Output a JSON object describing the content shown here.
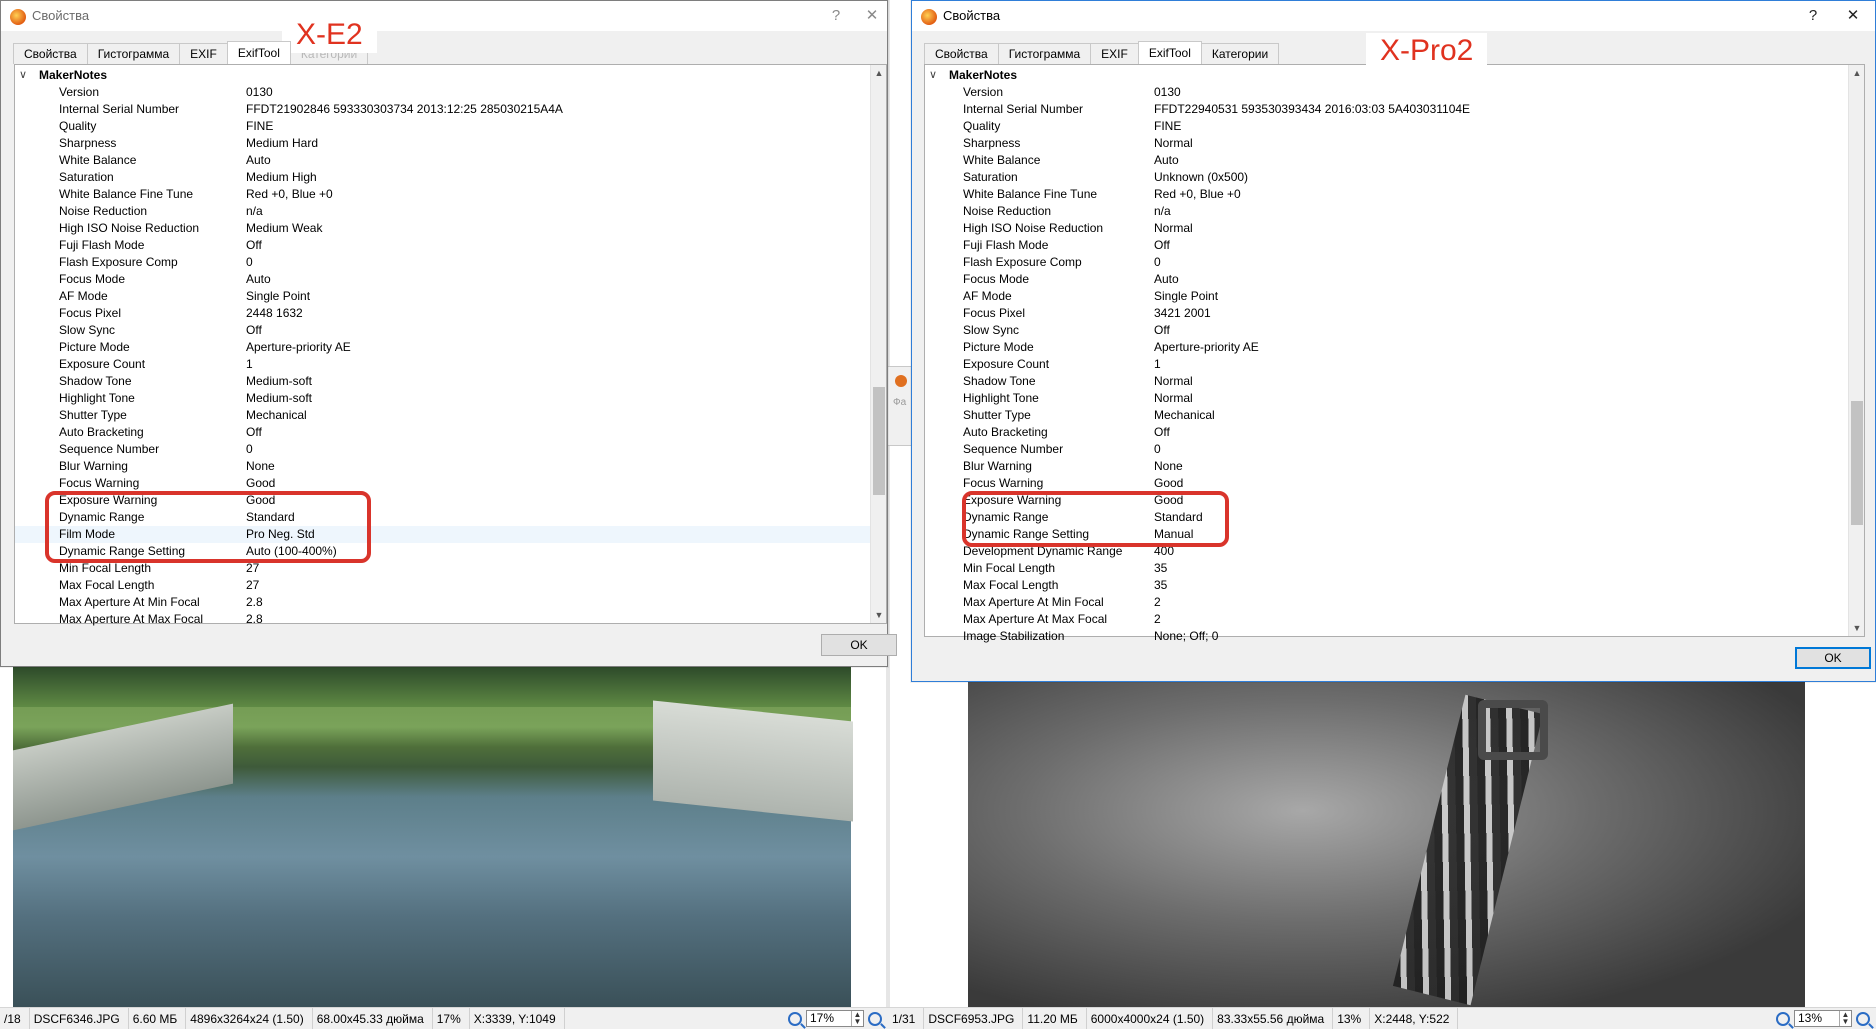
{
  "colors": {
    "annotation_red": "#d9342b",
    "selected_border": "#0078d7",
    "highlight_row": "#eef6fd"
  },
  "left": {
    "window_title": "Свойства",
    "help_symbol": "?",
    "close_symbol": "✕",
    "camera_label": "X-E2",
    "tabs": [
      "Свойства",
      "Гистограмма",
      "EXIF",
      "ExifTool",
      "Категории"
    ],
    "active_tab": "ExifTool",
    "section": "MakerNotes",
    "rows": [
      {
        "k": "Version",
        "v": "0130"
      },
      {
        "k": "Internal Serial Number",
        "v": "FFDT21902846 593330303734 2013:12:25 285030215A4A"
      },
      {
        "k": "Quality",
        "v": "FINE"
      },
      {
        "k": "Sharpness",
        "v": "Medium Hard"
      },
      {
        "k": "White Balance",
        "v": "Auto"
      },
      {
        "k": "Saturation",
        "v": "Medium High"
      },
      {
        "k": "White Balance Fine Tune",
        "v": "Red +0, Blue +0"
      },
      {
        "k": "Noise Reduction",
        "v": "n/a"
      },
      {
        "k": "High ISO Noise Reduction",
        "v": "Medium Weak"
      },
      {
        "k": "Fuji Flash Mode",
        "v": "Off"
      },
      {
        "k": "Flash Exposure Comp",
        "v": "0"
      },
      {
        "k": "Focus Mode",
        "v": "Auto"
      },
      {
        "k": "AF Mode",
        "v": "Single Point"
      },
      {
        "k": "Focus Pixel",
        "v": "2448 1632"
      },
      {
        "k": "Slow Sync",
        "v": "Off"
      },
      {
        "k": "Picture Mode",
        "v": "Aperture-priority AE"
      },
      {
        "k": "Exposure Count",
        "v": "1"
      },
      {
        "k": "Shadow Tone",
        "v": "Medium-soft"
      },
      {
        "k": "Highlight Tone",
        "v": "Medium-soft"
      },
      {
        "k": "Shutter Type",
        "v": "Mechanical"
      },
      {
        "k": "Auto Bracketing",
        "v": "Off"
      },
      {
        "k": "Sequence Number",
        "v": "0"
      },
      {
        "k": "Blur Warning",
        "v": "None"
      },
      {
        "k": "Focus Warning",
        "v": "Good"
      },
      {
        "k": "Exposure Warning",
        "v": "Good"
      },
      {
        "k": "Dynamic Range",
        "v": "Standard"
      },
      {
        "k": "Film Mode",
        "v": "Pro Neg. Std"
      },
      {
        "k": "Dynamic Range Setting",
        "v": "Auto (100-400%)"
      },
      {
        "k": "Min Focal Length",
        "v": "27"
      },
      {
        "k": "Max Focal Length",
        "v": "27"
      },
      {
        "k": "Max Aperture At Min Focal",
        "v": "2.8"
      },
      {
        "k": "Max Aperture At Max Focal",
        "v": "2.8"
      }
    ],
    "ok_label": "OK",
    "status": {
      "index": "/18",
      "file": "DSCF6346.JPG",
      "size": "6.60 МБ",
      "dims": "4896x3264x24 (1.50)",
      "inches": "68.00x45.33 дюйма",
      "zoom_pct": "17%",
      "coords": "X:3339, Y:1049",
      "zoom_box": "17%"
    }
  },
  "right": {
    "window_title": "Свойства",
    "help_symbol": "?",
    "close_symbol": "✕",
    "camera_label": "X-Pro2",
    "tabs": [
      "Свойства",
      "Гистограмма",
      "EXIF",
      "ExifTool",
      "Категории"
    ],
    "active_tab": "ExifTool",
    "section": "MakerNotes",
    "rows": [
      {
        "k": "Version",
        "v": "0130"
      },
      {
        "k": "Internal Serial Number",
        "v": "FFDT22940531 593530393434 2016:03:03 5A403031104E"
      },
      {
        "k": "Quality",
        "v": "FINE"
      },
      {
        "k": "Sharpness",
        "v": "Normal"
      },
      {
        "k": "White Balance",
        "v": "Auto"
      },
      {
        "k": "Saturation",
        "v": "Unknown (0x500)"
      },
      {
        "k": "White Balance Fine Tune",
        "v": "Red +0, Blue +0"
      },
      {
        "k": "Noise Reduction",
        "v": "n/a"
      },
      {
        "k": "High ISO Noise Reduction",
        "v": "Normal"
      },
      {
        "k": "Fuji Flash Mode",
        "v": "Off"
      },
      {
        "k": "Flash Exposure Comp",
        "v": "0"
      },
      {
        "k": "Focus Mode",
        "v": "Auto"
      },
      {
        "k": "AF Mode",
        "v": "Single Point"
      },
      {
        "k": "Focus Pixel",
        "v": "3421 2001"
      },
      {
        "k": "Slow Sync",
        "v": "Off"
      },
      {
        "k": "Picture Mode",
        "v": "Aperture-priority AE"
      },
      {
        "k": "Exposure Count",
        "v": "1"
      },
      {
        "k": "Shadow Tone",
        "v": "Normal"
      },
      {
        "k": "Highlight Tone",
        "v": "Normal"
      },
      {
        "k": "Shutter Type",
        "v": "Mechanical"
      },
      {
        "k": "Auto Bracketing",
        "v": "Off"
      },
      {
        "k": "Sequence Number",
        "v": "0"
      },
      {
        "k": "Blur Warning",
        "v": "None"
      },
      {
        "k": "Focus Warning",
        "v": "Good"
      },
      {
        "k": "Exposure Warning",
        "v": "Good"
      },
      {
        "k": "Dynamic Range",
        "v": "Standard"
      },
      {
        "k": "Dynamic Range Setting",
        "v": "Manual"
      },
      {
        "k": "Development Dynamic Range",
        "v": "400"
      },
      {
        "k": "Min Focal Length",
        "v": "35"
      },
      {
        "k": "Max Focal Length",
        "v": "35"
      },
      {
        "k": "Max Aperture At Min Focal",
        "v": "2"
      },
      {
        "k": "Max Aperture At Max Focal",
        "v": "2"
      },
      {
        "k": "Image Stabilization",
        "v": "None; Off; 0"
      }
    ],
    "ok_label": "OK",
    "status": {
      "index": "1/31",
      "file": "DSCF6953.JPG",
      "size": "11.20 МБ",
      "dims": "6000x4000x24 (1.50)",
      "inches": "83.33x55.56 дюйма",
      "zoom_pct": "13%",
      "coords": "X:2448, Y:522",
      "zoom_box": "13%"
    }
  },
  "background_window": {
    "partial_text": "Фа"
  }
}
